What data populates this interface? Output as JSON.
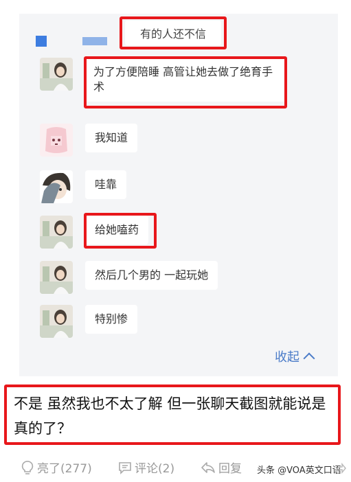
{
  "top_message": {
    "text": "有的人还不信"
  },
  "messages": [
    {
      "text": "为了方便陪睡 高管让她去做了绝育手术",
      "avatar": "girl-photo-avatar",
      "highlighted": true
    },
    {
      "text": "我知道",
      "avatar": "pink-cartoon-avatar",
      "highlighted": false
    },
    {
      "text": "哇靠",
      "avatar": "anime-character-avatar",
      "highlighted": false
    },
    {
      "text": "给她嗑药",
      "avatar": "girl-photo-avatar",
      "highlighted": true
    },
    {
      "text": "然后几个男的 一起玩她",
      "avatar": "girl-photo-avatar",
      "highlighted": false
    },
    {
      "text": "特别惨",
      "avatar": "girl-photo-avatar",
      "highlighted": false
    }
  ],
  "collapse": {
    "label": "收起"
  },
  "comment": {
    "text": "不是 虽然我也不太了解 但一张聊天截图就能说是真的了？"
  },
  "actions": {
    "like": "亮了(277)",
    "comment": "评论(2)",
    "reply": "回复"
  },
  "watermark": "头条 @VOA英文口语",
  "colors": {
    "highlight_border": "#e8171b",
    "link_blue": "#4a7bc8",
    "card_bg": "#f4f5f7"
  }
}
